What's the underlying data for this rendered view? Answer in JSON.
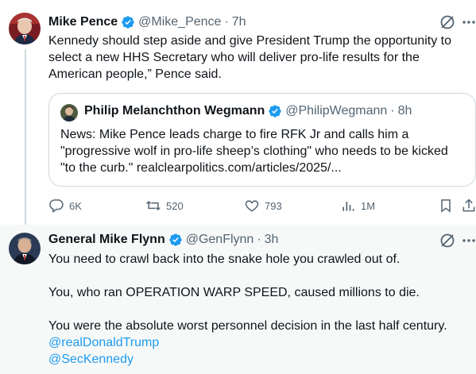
{
  "tweets": [
    {
      "author": "Mike Pence",
      "handle": "@Mike_Pence",
      "dot": "·",
      "time": "7h",
      "lines": [
        "Kennedy should step aside and give President Trump the opportunity to",
        "select a new HHS Secretary who will deliver pro-life results for the",
        "American people,” Pence said."
      ],
      "quote": {
        "author": "Philip Melanchthon Wegmann",
        "handle": "@PhilipWegmann",
        "dot": "·",
        "time": "8h",
        "lines": [
          "News: Mike Pence leads charge to fire RFK Jr and calls him a",
          "\"progressive wolf in pro-life sheep’s clothing\" who needs to be kicked",
          "\"to the curb.\" realclearpolitics.com/articles/2025/..."
        ]
      },
      "actions": {
        "replies": "6K",
        "reposts": "520",
        "likes": "793",
        "views": "1M"
      }
    },
    {
      "author": "General Mike Flynn",
      "handle": "@GenFlynn",
      "dot": "·",
      "time": "3h",
      "lines": [
        "You need to crawl back into the snake hole you crawled out of.",
        "",
        "You, who ran OPERATION WARP SPEED, caused millions to die.",
        "",
        "You were the absolute worst personnel decision in the last half century."
      ],
      "mentions": [
        "@realDonaldTrump",
        "@SecKennedy"
      ]
    }
  ],
  "colors": {
    "accent": "#1d9bf0",
    "secondary_text": "#536471",
    "border": "#cfd9de",
    "highlight_bg": "#f7f9f9"
  },
  "icons": [
    "verified-badge-icon",
    "grok-icon",
    "more-icon",
    "reply-icon",
    "repost-icon",
    "like-icon",
    "views-icon",
    "bookmark-icon",
    "share-icon"
  ]
}
